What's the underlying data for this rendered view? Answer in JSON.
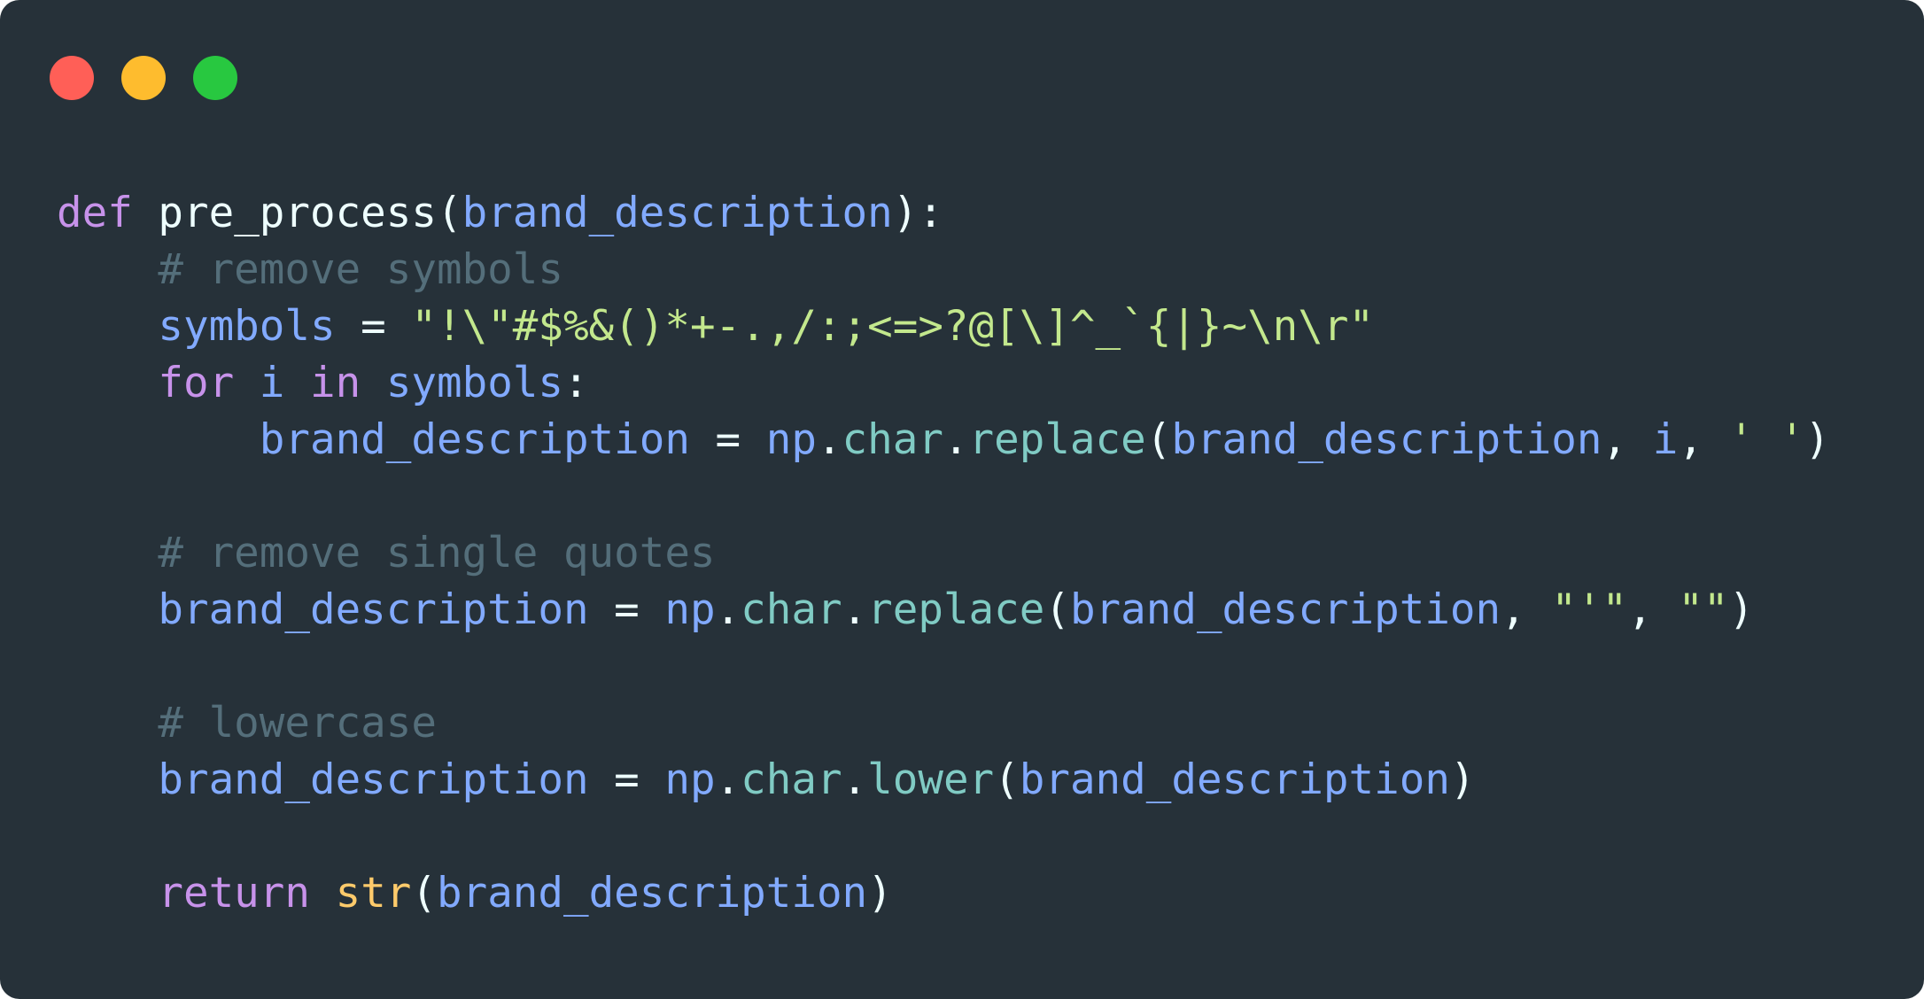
{
  "window_controls": {
    "close_color": "#ff5f57",
    "minimize_color": "#febc2e",
    "maximize_color": "#28c840"
  },
  "code": {
    "language": "python",
    "lines": [
      [
        {
          "t": "def",
          "c": "kw"
        },
        {
          "t": " ",
          "c": "op"
        },
        {
          "t": "pre_process",
          "c": "fn"
        },
        {
          "t": "(",
          "c": "op"
        },
        {
          "t": "brand_description",
          "c": "var"
        },
        {
          "t": "):",
          "c": "op"
        }
      ],
      [
        {
          "t": "    ",
          "c": "op"
        },
        {
          "t": "# remove symbols",
          "c": "cm"
        }
      ],
      [
        {
          "t": "    ",
          "c": "op"
        },
        {
          "t": "symbols",
          "c": "var"
        },
        {
          "t": " = ",
          "c": "op"
        },
        {
          "t": "\"!\\\"#$%&()*+-.,/:;<=>?@[\\]^_`{|}~\\n\\r\"",
          "c": "str"
        }
      ],
      [
        {
          "t": "    ",
          "c": "op"
        },
        {
          "t": "for",
          "c": "kw"
        },
        {
          "t": " ",
          "c": "op"
        },
        {
          "t": "i",
          "c": "var"
        },
        {
          "t": " ",
          "c": "op"
        },
        {
          "t": "in",
          "c": "kw"
        },
        {
          "t": " ",
          "c": "op"
        },
        {
          "t": "symbols",
          "c": "var"
        },
        {
          "t": ":",
          "c": "op"
        }
      ],
      [
        {
          "t": "        ",
          "c": "op"
        },
        {
          "t": "brand_description",
          "c": "var"
        },
        {
          "t": " = ",
          "c": "op"
        },
        {
          "t": "np",
          "c": "var"
        },
        {
          "t": ".",
          "c": "op"
        },
        {
          "t": "char",
          "c": "attr"
        },
        {
          "t": ".",
          "c": "op"
        },
        {
          "t": "replace",
          "c": "attr"
        },
        {
          "t": "(",
          "c": "op"
        },
        {
          "t": "brand_description",
          "c": "var"
        },
        {
          "t": ", ",
          "c": "op"
        },
        {
          "t": "i",
          "c": "var"
        },
        {
          "t": ", ",
          "c": "op"
        },
        {
          "t": "' '",
          "c": "str"
        },
        {
          "t": ")",
          "c": "op"
        }
      ],
      [],
      [
        {
          "t": "    ",
          "c": "op"
        },
        {
          "t": "# remove single quotes",
          "c": "cm"
        }
      ],
      [
        {
          "t": "    ",
          "c": "op"
        },
        {
          "t": "brand_description",
          "c": "var"
        },
        {
          "t": " = ",
          "c": "op"
        },
        {
          "t": "np",
          "c": "var"
        },
        {
          "t": ".",
          "c": "op"
        },
        {
          "t": "char",
          "c": "attr"
        },
        {
          "t": ".",
          "c": "op"
        },
        {
          "t": "replace",
          "c": "attr"
        },
        {
          "t": "(",
          "c": "op"
        },
        {
          "t": "brand_description",
          "c": "var"
        },
        {
          "t": ", ",
          "c": "op"
        },
        {
          "t": "\"'\"",
          "c": "str"
        },
        {
          "t": ", ",
          "c": "op"
        },
        {
          "t": "\"\"",
          "c": "str"
        },
        {
          "t": ")",
          "c": "op"
        }
      ],
      [],
      [
        {
          "t": "    ",
          "c": "op"
        },
        {
          "t": "# lowercase",
          "c": "cm"
        }
      ],
      [
        {
          "t": "    ",
          "c": "op"
        },
        {
          "t": "brand_description",
          "c": "var"
        },
        {
          "t": " = ",
          "c": "op"
        },
        {
          "t": "np",
          "c": "var"
        },
        {
          "t": ".",
          "c": "op"
        },
        {
          "t": "char",
          "c": "attr"
        },
        {
          "t": ".",
          "c": "op"
        },
        {
          "t": "lower",
          "c": "attr"
        },
        {
          "t": "(",
          "c": "op"
        },
        {
          "t": "brand_description",
          "c": "var"
        },
        {
          "t": ")",
          "c": "op"
        }
      ],
      [],
      [
        {
          "t": "    ",
          "c": "op"
        },
        {
          "t": "return",
          "c": "kw"
        },
        {
          "t": " ",
          "c": "op"
        },
        {
          "t": "str",
          "c": "bi"
        },
        {
          "t": "(",
          "c": "op"
        },
        {
          "t": "brand_description",
          "c": "var"
        },
        {
          "t": ")",
          "c": "op"
        }
      ]
    ]
  }
}
